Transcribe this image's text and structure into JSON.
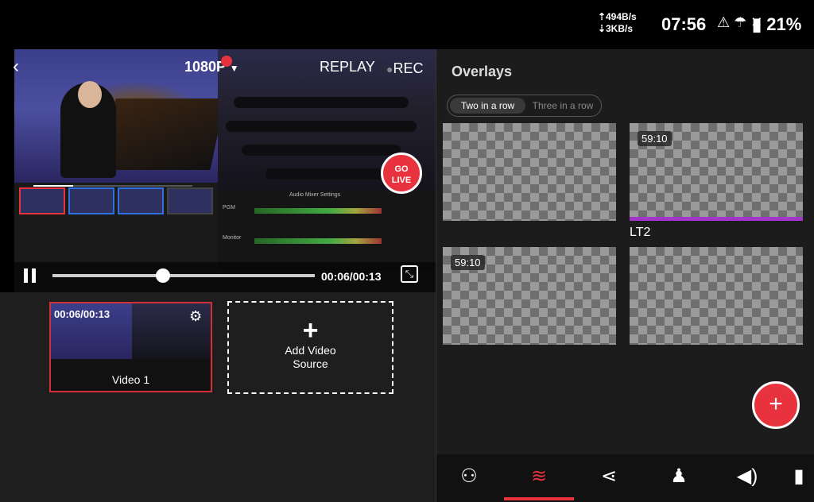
{
  "status_bar": {
    "net_up": "494B/s",
    "net_down": "3KB/s",
    "time": "07:56",
    "battery": "21%"
  },
  "preview": {
    "resolution": "1080P",
    "replay_label": "REPLAY",
    "rec_label": "REC",
    "go_live_line1": "GO",
    "go_live_line2": "LIVE",
    "timecode": "00:06/00:13",
    "playback_progress": 0.41,
    "pgm_label": "PGM",
    "monitor_label": "Monitor",
    "audio_mixer_label": "Audio Mixer Settings"
  },
  "sources": {
    "video1": {
      "timecode": "00:06/00:13",
      "name": "Video 1"
    },
    "add_source_line1": "Add Video",
    "add_source_line2": "Source"
  },
  "overlays": {
    "title": "Overlays",
    "layout_options": [
      "Two in a row",
      "Three in a row"
    ],
    "selected_layout": "Two in a row",
    "tiles": [
      {
        "badge": "",
        "label": ""
      },
      {
        "badge": "59:10",
        "label": "LT2"
      },
      {
        "badge": "59:10",
        "label": ""
      },
      {
        "badge": "",
        "label": ""
      }
    ],
    "add_button": "+"
  },
  "bottom_nav": [
    {
      "icon": "mixer-icon",
      "active": false
    },
    {
      "icon": "layers-icon",
      "active": true
    },
    {
      "icon": "share-icon",
      "active": false
    },
    {
      "icon": "guests-icon",
      "active": false
    },
    {
      "icon": "audio-icon",
      "active": false
    }
  ]
}
